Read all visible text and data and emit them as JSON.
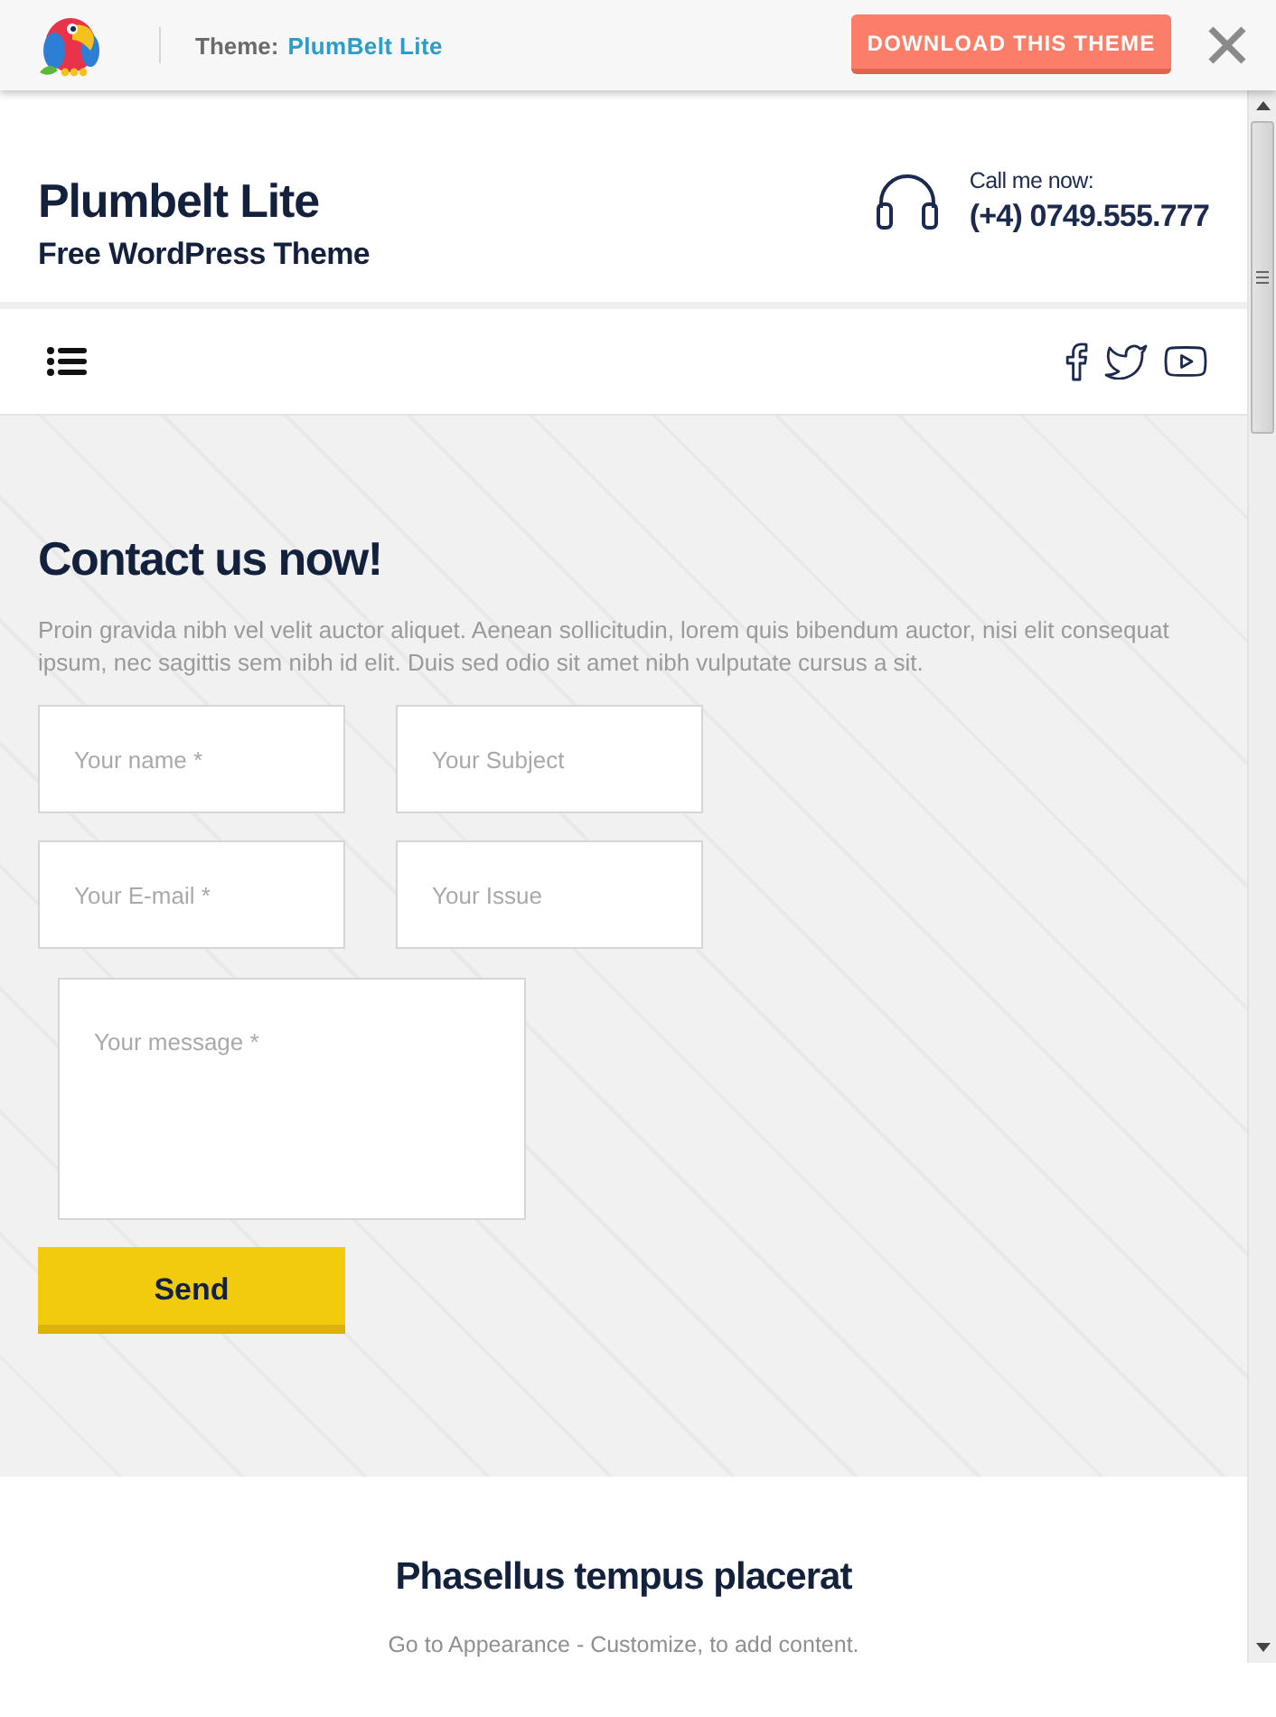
{
  "topbar": {
    "theme_label": "Theme:",
    "theme_name": "PlumBelt Lite",
    "download_button": "DOWNLOAD THIS THEME"
  },
  "header": {
    "site_title": "Plumbelt Lite",
    "tagline": "Free WordPress Theme",
    "call_label": "Call me now:",
    "phone": "(+4) 0749.555.777"
  },
  "contact": {
    "heading": "Contact us now!",
    "intro": "Proin gravida nibh vel velit auctor aliquet. Aenean sollicitudin, lorem quis bibendum auctor, nisi elit consequat ipsum, nec sagittis sem nibh id elit. Duis sed odio sit amet nibh vulputate cursus a sit.",
    "fields": [
      {
        "placeholder": "Your name *"
      },
      {
        "placeholder": "Your Subject"
      },
      {
        "placeholder": "Your E-mail *"
      },
      {
        "placeholder": "Your Issue"
      }
    ],
    "message": {
      "placeholder": "Your message *"
    },
    "send_button": "Send"
  },
  "widget": {
    "heading": "Phasellus tempus placerat",
    "text": "Go to Appearance - Customize, to add content."
  }
}
